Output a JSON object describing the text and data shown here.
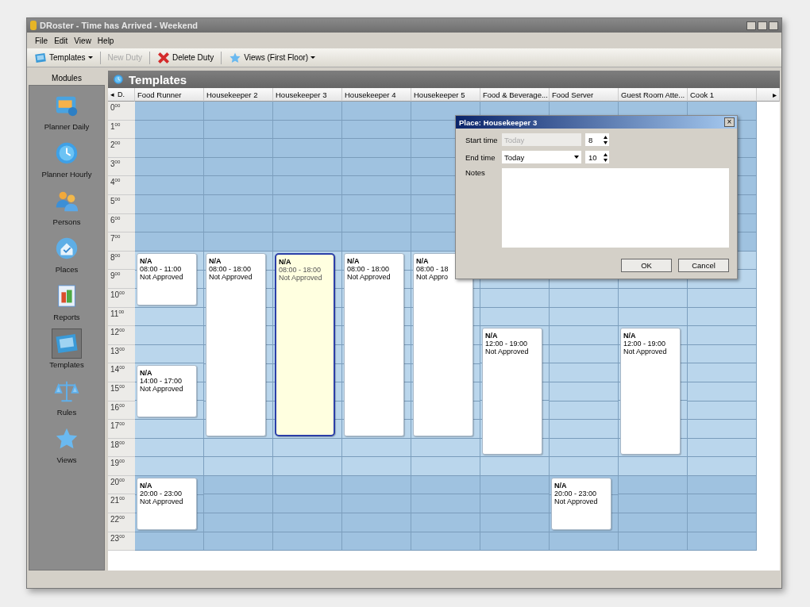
{
  "window": {
    "title": "DRoster - Time has Arrived - Weekend"
  },
  "menu": [
    "File",
    "Edit",
    "View",
    "Help"
  ],
  "toolbar": [
    {
      "label": "Templates",
      "kind": "dropdown",
      "disabled": false
    },
    {
      "label": "New Duty",
      "kind": "button",
      "disabled": true
    },
    {
      "label": "Delete Duty",
      "kind": "button",
      "disabled": false
    },
    {
      "label": "Views (First Floor)",
      "kind": "dropdown",
      "disabled": false
    }
  ],
  "sidebar": {
    "title": "Modules",
    "items": [
      {
        "label": "Planner Daily",
        "selected": false
      },
      {
        "label": "Planner Hourly",
        "selected": false
      },
      {
        "label": "Persons",
        "selected": false
      },
      {
        "label": "Places",
        "selected": false
      },
      {
        "label": "Reports",
        "selected": false
      },
      {
        "label": "Templates",
        "selected": true
      },
      {
        "label": "Rules",
        "selected": false
      },
      {
        "label": "Views",
        "selected": false
      }
    ]
  },
  "panel": {
    "title": "Templates"
  },
  "grid": {
    "corner": "D.",
    "scroll_left": "◂",
    "scroll_right": "▸",
    "rows": [
      {
        "hour": "0$^{00}$",
        "shaded": true
      },
      {
        "hour": "1$^{00}$",
        "shaded": true
      },
      {
        "hour": "2$^{00}$",
        "shaded": true
      },
      {
        "hour": "3$^{00}$",
        "shaded": true
      },
      {
        "hour": "4$^{00}$",
        "shaded": true
      },
      {
        "hour": "5$^{00}$",
        "shaded": true
      },
      {
        "hour": "6$^{00}$",
        "shaded": true
      },
      {
        "hour": "7$^{00}$",
        "shaded": true
      },
      {
        "hour": "8$^{00}$",
        "shaded": false
      },
      {
        "hour": "9$^{00}$",
        "shaded": false
      },
      {
        "hour": "10$^{00}$",
        "shaded": false
      },
      {
        "hour": "11$^{00}$",
        "shaded": false
      },
      {
        "hour": "12$^{00}$",
        "shaded": false
      },
      {
        "hour": "13$^{00}$",
        "shaded": false
      },
      {
        "hour": "14$^{00}$",
        "shaded": false
      },
      {
        "hour": "15$^{00}$",
        "shaded": false
      },
      {
        "hour": "16$^{00}$",
        "shaded": false
      },
      {
        "hour": "17$^{00}$",
        "shaded": false
      },
      {
        "hour": "18$^{00}$",
        "shaded": false
      },
      {
        "hour": "19$^{00}$",
        "shaded": false
      },
      {
        "hour": "20$^{00}$",
        "shaded": true
      },
      {
        "hour": "21$^{00}$",
        "shaded": true
      },
      {
        "hour": "22$^{00}$",
        "shaded": true
      },
      {
        "hour": "23$^{00}$",
        "shaded": true
      }
    ],
    "columns": [
      {
        "name": "Food Runner",
        "duties": [
          {
            "title": "N/A",
            "time": "08:00 - 11:00",
            "status": "Not Approved",
            "selected": false
          },
          {
            "title": "N/A",
            "time": "14:00 - 17:00",
            "status": "Not Approved",
            "selected": false
          },
          {
            "title": "N/A",
            "time": "20:00 - 23:00",
            "status": "Not Approved",
            "selected": false
          }
        ]
      },
      {
        "name": "Housekeeper 2",
        "duties": [
          {
            "title": "N/A",
            "time": "08:00 - 18:00",
            "status": "Not Approved",
            "selected": false
          }
        ]
      },
      {
        "name": "Housekeeper 3",
        "duties": [
          {
            "title": "N/A",
            "time": "08:00 - 18:00",
            "status": "Not Approved",
            "selected": true
          }
        ]
      },
      {
        "name": "Housekeeper 4",
        "duties": [
          {
            "title": "N/A",
            "time": "08:00 - 18:00",
            "status": "Not Approved",
            "selected": false
          }
        ]
      },
      {
        "name": "Housekeeper 5",
        "duties": [
          {
            "title": "N/A",
            "time": "08:00 - 18",
            "status": "Not Appro",
            "selected": false
          }
        ]
      },
      {
        "name": "Food & Beverage...",
        "duties": [
          {
            "title": "N/A",
            "time": "12:00 - 19:00",
            "status": "Not Approved",
            "selected": false
          }
        ]
      },
      {
        "name": "Food Server",
        "duties": [
          {
            "title": "N/A",
            "time": "20:00 - 23:00",
            "status": "Not Approved",
            "selected": false
          }
        ]
      },
      {
        "name": "Guest Room Atte...",
        "duties": [
          {
            "title": "N/A",
            "time": "12:00 - 19:00",
            "status": "Not Approved",
            "selected": false
          }
        ]
      },
      {
        "name": "Cook 1"
      }
    ]
  },
  "dialog": {
    "title": "Place: Housekeeper 3",
    "close": "×",
    "start_label": "Start time",
    "start_date": "Today",
    "start_date_disabled": true,
    "start_hour": "8",
    "end_label": "End time",
    "end_date": "Today",
    "end_hour": "10",
    "notes_label": "Notes",
    "buttons": [
      "OK",
      "Cancel"
    ]
  }
}
